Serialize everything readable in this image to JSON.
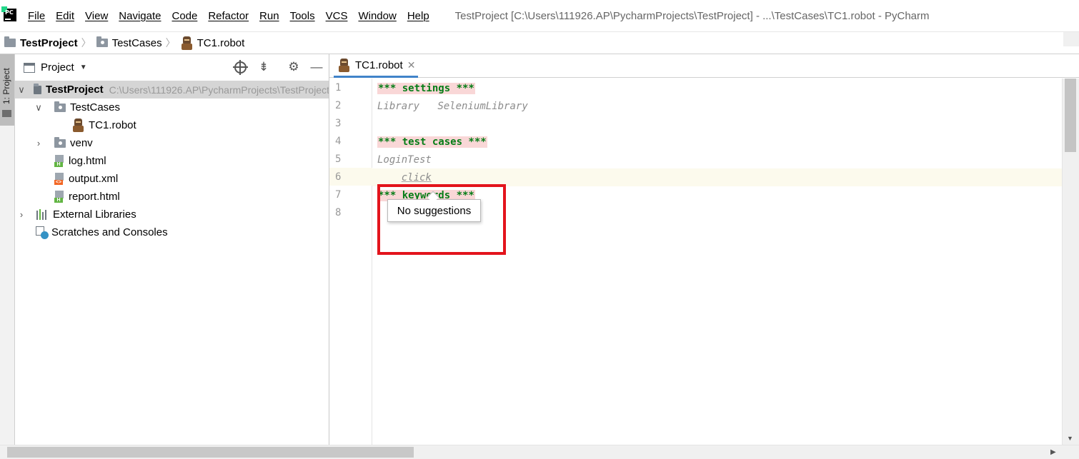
{
  "app": {
    "window_title": "TestProject [C:\\Users\\111926.AP\\PycharmProjects\\TestProject] - ...\\TestCases\\TC1.robot - PyCharm",
    "brand_color": "#21d789"
  },
  "menu": {
    "items": [
      "File",
      "Edit",
      "View",
      "Navigate",
      "Code",
      "Refactor",
      "Run",
      "Tools",
      "VCS",
      "Window",
      "Help"
    ]
  },
  "breadcrumb": {
    "items": [
      "TestProject",
      "TestCases",
      "TC1.robot"
    ]
  },
  "tool_stripe": {
    "project_tab_label": "1: Project"
  },
  "project_panel": {
    "title": "Project",
    "tree": [
      {
        "label": "TestProject",
        "hint": "C:\\Users\\111926.AP\\PycharmProjects\\TestProject",
        "type": "project",
        "expanded": true
      },
      {
        "label": "TestCases",
        "type": "folder",
        "expanded": true
      },
      {
        "label": "TC1.robot",
        "type": "robot"
      },
      {
        "label": "venv",
        "type": "folder",
        "expanded": false
      },
      {
        "label": "log.html",
        "type": "html"
      },
      {
        "label": "output.xml",
        "type": "xml"
      },
      {
        "label": "report.html",
        "type": "html"
      },
      {
        "label": "External Libraries",
        "type": "library",
        "expanded": false
      },
      {
        "label": "Scratches and Consoles",
        "type": "scratch"
      }
    ]
  },
  "editor": {
    "tab_label": "TC1.robot",
    "line_numbers": [
      "1",
      "2",
      "3",
      "4",
      "5",
      "6",
      "7",
      "8"
    ],
    "lines": {
      "l1": "*** settings ***",
      "l2a": "Library",
      "l2b": "SeleniumLibrary",
      "l4": "*** test cases ***",
      "l5": "LoginTest",
      "l6": "click",
      "l7": "*** keywords ***"
    },
    "popup_text": "No suggestions"
  }
}
